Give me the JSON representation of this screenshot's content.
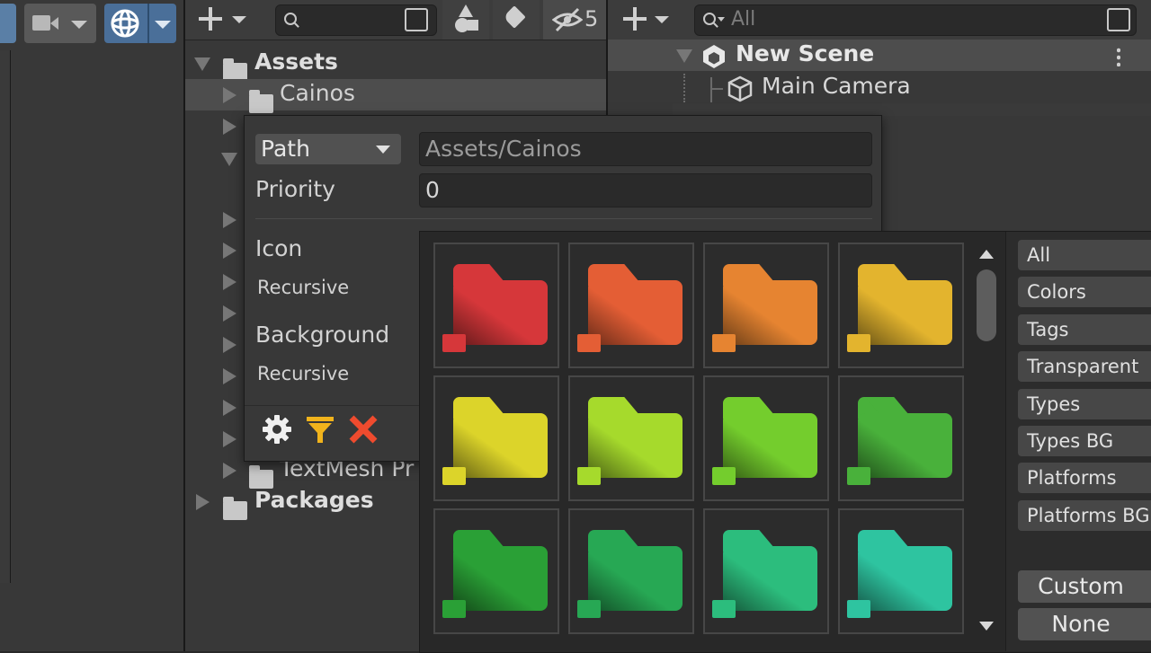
{
  "project": {
    "hidden_count": "5",
    "tree": {
      "assets_label": "Assets",
      "cainos_label": "Cainos",
      "textmesh_label": "TextMesh Pr",
      "packages_label": "Packages"
    }
  },
  "hierarchy": {
    "search_placeholder": "All",
    "scene_name": "New Scene",
    "camera_label": "Main Camera"
  },
  "settings": {
    "mode_value": "Path",
    "path_placeholder": "Assets/Cainos",
    "priority_label": "Priority",
    "priority_value": "0",
    "icon_label": "Icon",
    "icon_recursive_label": "Recursive",
    "background_label": "Background",
    "background_recursive_label": "Recursive"
  },
  "picker": {
    "categories": [
      "All",
      "Colors",
      "Tags",
      "Transparent",
      "Types",
      "Types BG",
      "Platforms",
      "Platforms BG"
    ],
    "custom_label": "Custom",
    "none_label": "None",
    "swatches": [
      "#d6373a",
      "#e45e35",
      "#e68431",
      "#e3b42e",
      "#dcd42a",
      "#a6da2c",
      "#74cd2d",
      "#49b13b",
      "#2aa036",
      "#27a854",
      "#2cbd7d",
      "#2ec4a0"
    ]
  },
  "colors": {
    "accent": "#4a6f99",
    "panel_bg": "#383838",
    "filter_icon": "#f1b31c",
    "clear_icon": "#ef4b2e"
  }
}
